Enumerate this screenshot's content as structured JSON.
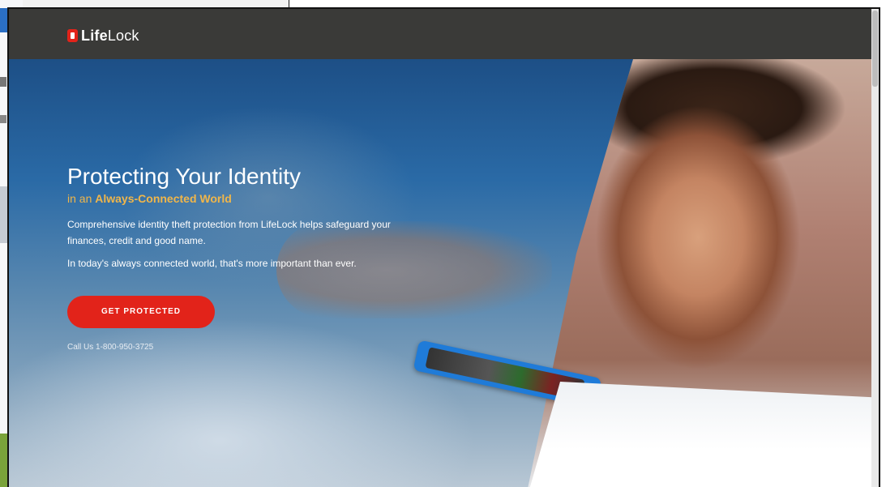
{
  "brand": {
    "name_bold": "Life",
    "name_light": "Lock",
    "accent_color": "#e2231a"
  },
  "hero": {
    "headline": "Protecting Your Identity",
    "subheadline_prefix": "in an ",
    "subheadline_strong": "Always-Connected World",
    "paragraph_1": "Comprehensive identity theft protection from LifeLock helps safeguard your finances, credit and good name.",
    "paragraph_2": "In today's always connected world, that's more important than ever.",
    "cta_label": "GET PROTECTED",
    "call_text": "Call Us 1-800-950-3725"
  },
  "icons": {
    "logo": "lifelock-lock-icon"
  }
}
